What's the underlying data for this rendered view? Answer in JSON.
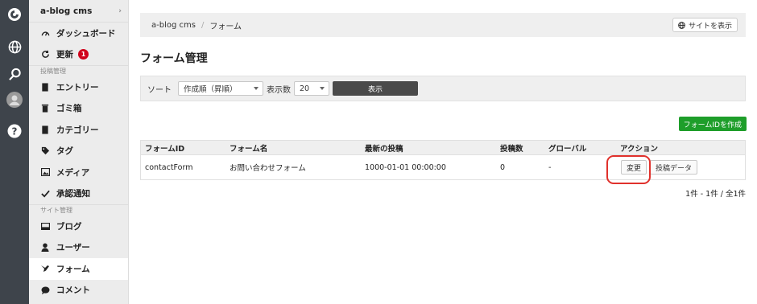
{
  "sidebar": {
    "site_name": "a-blog cms",
    "items_top": [
      {
        "label": "ダッシュボード",
        "icon": "dashboard-icon"
      },
      {
        "label": "更新",
        "icon": "refresh-icon",
        "badge": "1"
      }
    ],
    "section_posts": "投稿管理",
    "items_posts": [
      {
        "label": "エントリー",
        "icon": "entry-icon"
      },
      {
        "label": "ゴミ箱",
        "icon": "trash-icon"
      },
      {
        "label": "カテゴリー",
        "icon": "category-icon"
      },
      {
        "label": "タグ",
        "icon": "tag-icon"
      },
      {
        "label": "メディア",
        "icon": "media-icon"
      },
      {
        "label": "承認通知",
        "icon": "check-icon"
      }
    ],
    "section_site": "サイト管理",
    "items_site": [
      {
        "label": "ブログ",
        "icon": "blog-icon"
      },
      {
        "label": "ユーザー",
        "icon": "user-icon"
      },
      {
        "label": "フォーム",
        "icon": "form-icon",
        "active": true
      },
      {
        "label": "コメント",
        "icon": "comment-icon"
      }
    ]
  },
  "breadcrumb": {
    "root": "a-blog cms",
    "current": "フォーム"
  },
  "view_site_label": "サイトを表示",
  "page_title": "フォーム管理",
  "filter": {
    "sort_label": "ソート",
    "sort_value": "作成順（昇順）",
    "count_label": "表示数",
    "count_value": "20",
    "show_label": "表示"
  },
  "create_label": "フォームIDを作成",
  "table": {
    "headers": [
      "フォームID",
      "フォーム名",
      "最新の投稿",
      "投稿数",
      "グローバル",
      "アクション"
    ],
    "rows": [
      {
        "id": "contactForm",
        "name": "お問い合わせフォーム",
        "latest": "1000-01-01 00:00:00",
        "posts": "0",
        "global": "-",
        "edit_label": "変更",
        "data_label": "投稿データ"
      }
    ]
  },
  "pagination": "1件 - 1件 / 全1件",
  "colors": {
    "rail": "#3e444b",
    "create_button": "#1e9e2a",
    "highlight": "#e0312c",
    "badge": "#d0021b"
  }
}
